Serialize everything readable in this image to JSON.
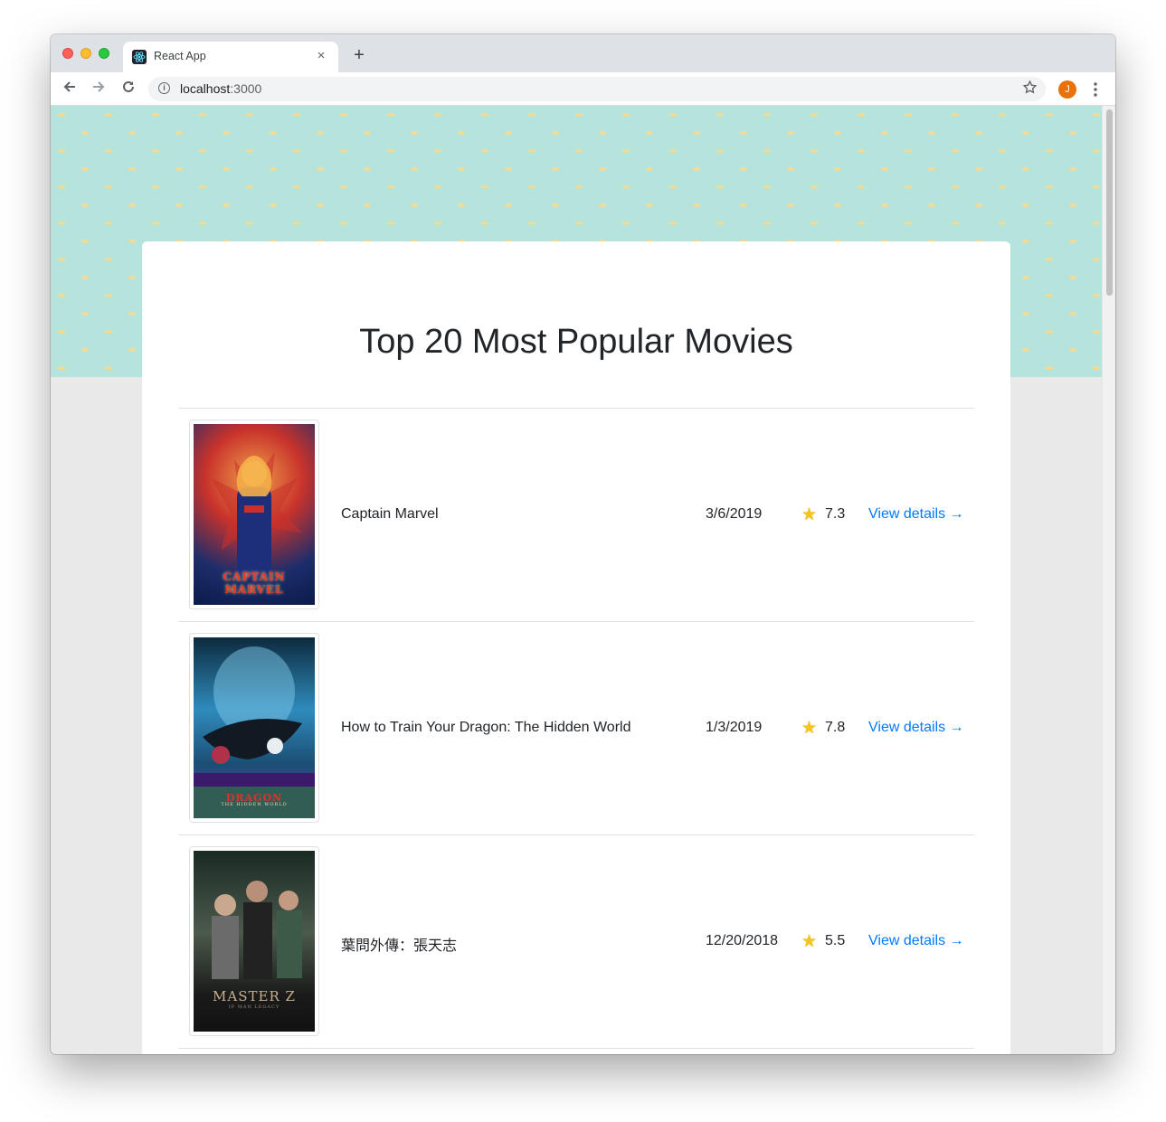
{
  "browser": {
    "tab_title": "React App",
    "tab_close": "×",
    "new_tab": "+",
    "url_host": "localhost",
    "url_port": ":3000",
    "avatar_initial": "J",
    "icons": {
      "back": "arrow-left-icon",
      "forward": "arrow-right-icon",
      "reload": "reload-icon",
      "info": "info-icon",
      "bookmark": "star-icon",
      "menu": "more-vert-icon"
    }
  },
  "page": {
    "title": "Top 20 Most Popular Movies"
  },
  "movies": [
    {
      "title": "Captain Marvel",
      "release_date": "3/6/2019",
      "rating": "7.3",
      "link_label": "View details →",
      "poster_caption": "CAPTAIN MARVEL",
      "poster_colors": [
        "#0b1b4a",
        "#c8322b",
        "#f0a04b"
      ]
    },
    {
      "title": "How to Train Your Dragon: The Hidden World",
      "release_date": "1/3/2019",
      "rating": "7.8",
      "link_label": "View details →",
      "poster_caption": "DRAGON",
      "poster_sub": "THE HIDDEN WORLD",
      "poster_colors": [
        "#0c2a3d",
        "#2f8bbd",
        "#6a2aa8"
      ]
    },
    {
      "title": "葉問外傳：張天志",
      "release_date": "12/20/2018",
      "rating": "5.5",
      "link_label": "View details →",
      "poster_caption": "MASTER Z",
      "poster_sub": "IP MAN LEGACY",
      "poster_colors": [
        "#1a2a24",
        "#4c5a4c",
        "#111111"
      ]
    }
  ],
  "colors": {
    "link": "#007bff",
    "hero_bg": "#b5e4dd",
    "star": "#f5c518"
  }
}
